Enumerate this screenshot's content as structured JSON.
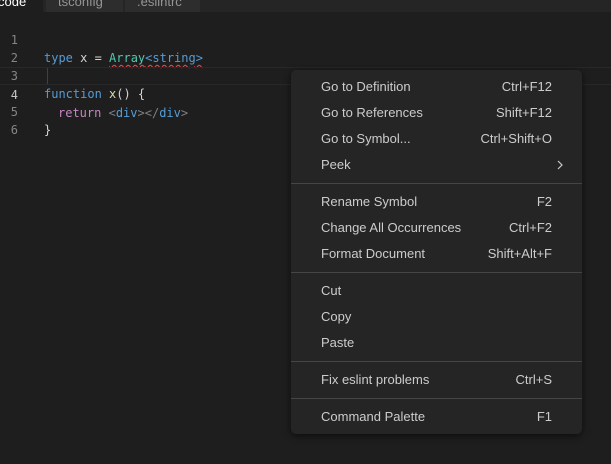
{
  "tabs": [
    {
      "label": "code",
      "active": true
    },
    {
      "label": "tsconfig",
      "active": false
    },
    {
      "label": ".eslintrc",
      "active": false
    }
  ],
  "editor": {
    "line_numbers": [
      "1",
      "2",
      "3",
      "4",
      "5",
      "6"
    ],
    "lines": {
      "l1": {
        "kw": "type",
        "name": " x = ",
        "type_name": "Array",
        "generic": "<string>"
      },
      "l3": {
        "kw": "function",
        "name": " x",
        "rest": "() {"
      },
      "l4": {
        "kw": "return",
        "open_lt": "<",
        "open_tag": "div",
        "open_gt": ">",
        "close_lt": "</",
        "close_tag": "div",
        "close_gt": ">"
      },
      "l5": {
        "text": "}"
      }
    }
  },
  "context_menu": {
    "groups": [
      [
        {
          "label": "Go to Definition",
          "shortcut": "Ctrl+F12"
        },
        {
          "label": "Go to References",
          "shortcut": "Shift+F12"
        },
        {
          "label": "Go to Symbol...",
          "shortcut": "Ctrl+Shift+O"
        },
        {
          "label": "Peek",
          "shortcut": "",
          "submenu": true
        }
      ],
      [
        {
          "label": "Rename Symbol",
          "shortcut": "F2"
        },
        {
          "label": "Change All Occurrences",
          "shortcut": "Ctrl+F2"
        },
        {
          "label": "Format Document",
          "shortcut": "Shift+Alt+F"
        }
      ],
      [
        {
          "label": "Cut",
          "shortcut": ""
        },
        {
          "label": "Copy",
          "shortcut": ""
        },
        {
          "label": "Paste",
          "shortcut": ""
        }
      ],
      [
        {
          "label": "Fix eslint problems",
          "shortcut": "Ctrl+S"
        }
      ],
      [
        {
          "label": "Command Palette",
          "shortcut": "F1"
        }
      ]
    ]
  },
  "colors": {
    "editor_bg": "#1e1e1e",
    "menu_bg": "#252526",
    "keyword": "#569cd6",
    "function": "#dcdcaa",
    "type": "#4ec9b0",
    "error_squiggle": "#f14c4c"
  },
  "icons": {
    "submenu": "chevron-right-icon"
  }
}
